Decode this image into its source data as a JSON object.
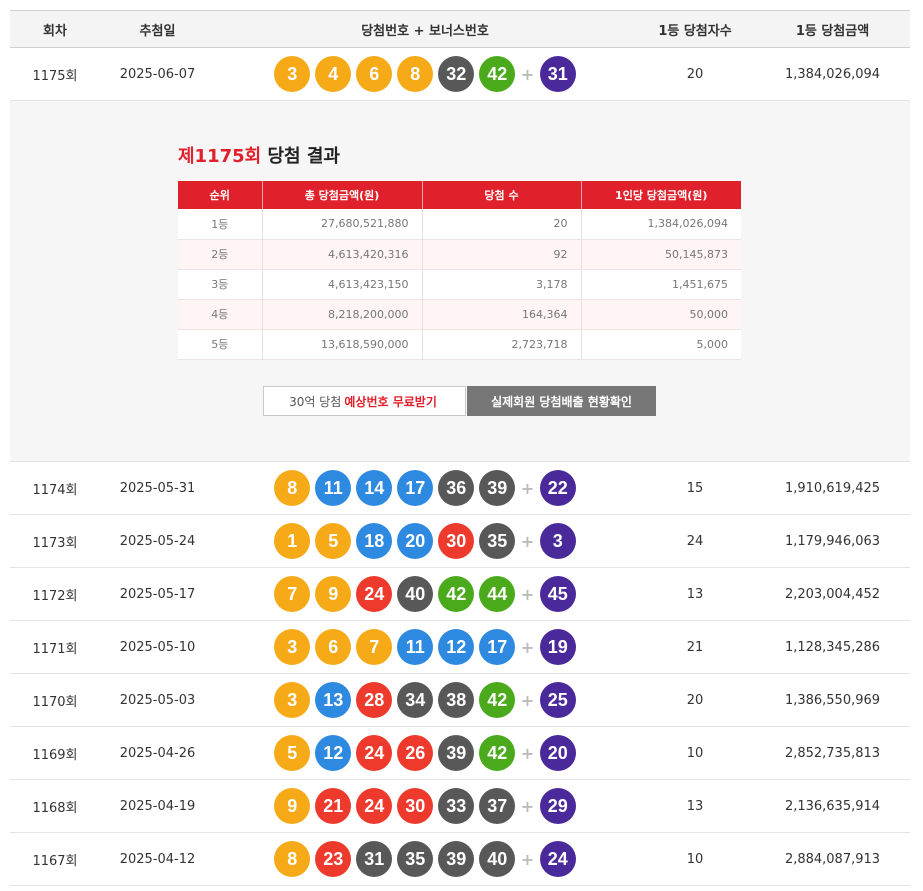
{
  "header": {
    "round": "회차",
    "date": "추첨일",
    "numbers": "당첨번호 + 보너스번호",
    "winners": "1등 당첨자수",
    "prize": "1등 당첨금액"
  },
  "plus_sign": "+",
  "ball_colors": {
    "yellow": "#f6aa17",
    "blue": "#2e8ae0",
    "red": "#ee3a2c",
    "gray": "#585858",
    "green": "#4aaa1c",
    "bonus": "#4a2a9a"
  },
  "draws": [
    {
      "round": "1175회",
      "date": "2025-06-07",
      "numbers": [
        3,
        4,
        6,
        8,
        32,
        42
      ],
      "bonus": 31,
      "winners": "20",
      "prize": "1,384,026,094"
    },
    {
      "round": "1174회",
      "date": "2025-05-31",
      "numbers": [
        8,
        11,
        14,
        17,
        36,
        39
      ],
      "bonus": 22,
      "winners": "15",
      "prize": "1,910,619,425"
    },
    {
      "round": "1173회",
      "date": "2025-05-24",
      "numbers": [
        1,
        5,
        18,
        20,
        30,
        35
      ],
      "bonus": 3,
      "winners": "24",
      "prize": "1,179,946,063"
    },
    {
      "round": "1172회",
      "date": "2025-05-17",
      "numbers": [
        7,
        9,
        24,
        40,
        42,
        44
      ],
      "bonus": 45,
      "winners": "13",
      "prize": "2,203,004,452"
    },
    {
      "round": "1171회",
      "date": "2025-05-10",
      "numbers": [
        3,
        6,
        7,
        11,
        12,
        17
      ],
      "bonus": 19,
      "winners": "21",
      "prize": "1,128,345,286"
    },
    {
      "round": "1170회",
      "date": "2025-05-03",
      "numbers": [
        3,
        13,
        28,
        34,
        38,
        42
      ],
      "bonus": 25,
      "winners": "20",
      "prize": "1,386,550,969"
    },
    {
      "round": "1169회",
      "date": "2025-04-26",
      "numbers": [
        5,
        12,
        24,
        26,
        39,
        42
      ],
      "bonus": 20,
      "winners": "10",
      "prize": "2,852,735,813"
    },
    {
      "round": "1168회",
      "date": "2025-04-19",
      "numbers": [
        9,
        21,
        24,
        30,
        33,
        37
      ],
      "bonus": 29,
      "winners": "13",
      "prize": "2,136,635,914"
    },
    {
      "round": "1167회",
      "date": "2025-04-12",
      "numbers": [
        8,
        23,
        31,
        35,
        39,
        40
      ],
      "bonus": 24,
      "winners": "10",
      "prize": "2,884,087,913"
    }
  ],
  "detail": {
    "title_red": "제1175회",
    "title_rest": " 당첨 결과",
    "columns": [
      "순위",
      "총 당첨금액(원)",
      "당첨 수",
      "1인당 당첨금액(원)"
    ],
    "rows": [
      {
        "rank": "1등",
        "total": "27,680,521,880",
        "count": "20",
        "per": "1,384,026,094"
      },
      {
        "rank": "2등",
        "total": "4,613,420,316",
        "count": "92",
        "per": "50,145,873"
      },
      {
        "rank": "3등",
        "total": "4,613,423,150",
        "count": "3,178",
        "per": "1,451,675"
      },
      {
        "rank": "4등",
        "total": "8,218,200,000",
        "count": "164,364",
        "per": "50,000"
      },
      {
        "rank": "5등",
        "total": "13,618,590,000",
        "count": "2,723,718",
        "per": "5,000"
      }
    ],
    "button1": {
      "pre": "30억 당첨",
      "highlight": "예상번호 무료받기"
    },
    "button2": "실제회원 당첨배출 현황확인"
  }
}
